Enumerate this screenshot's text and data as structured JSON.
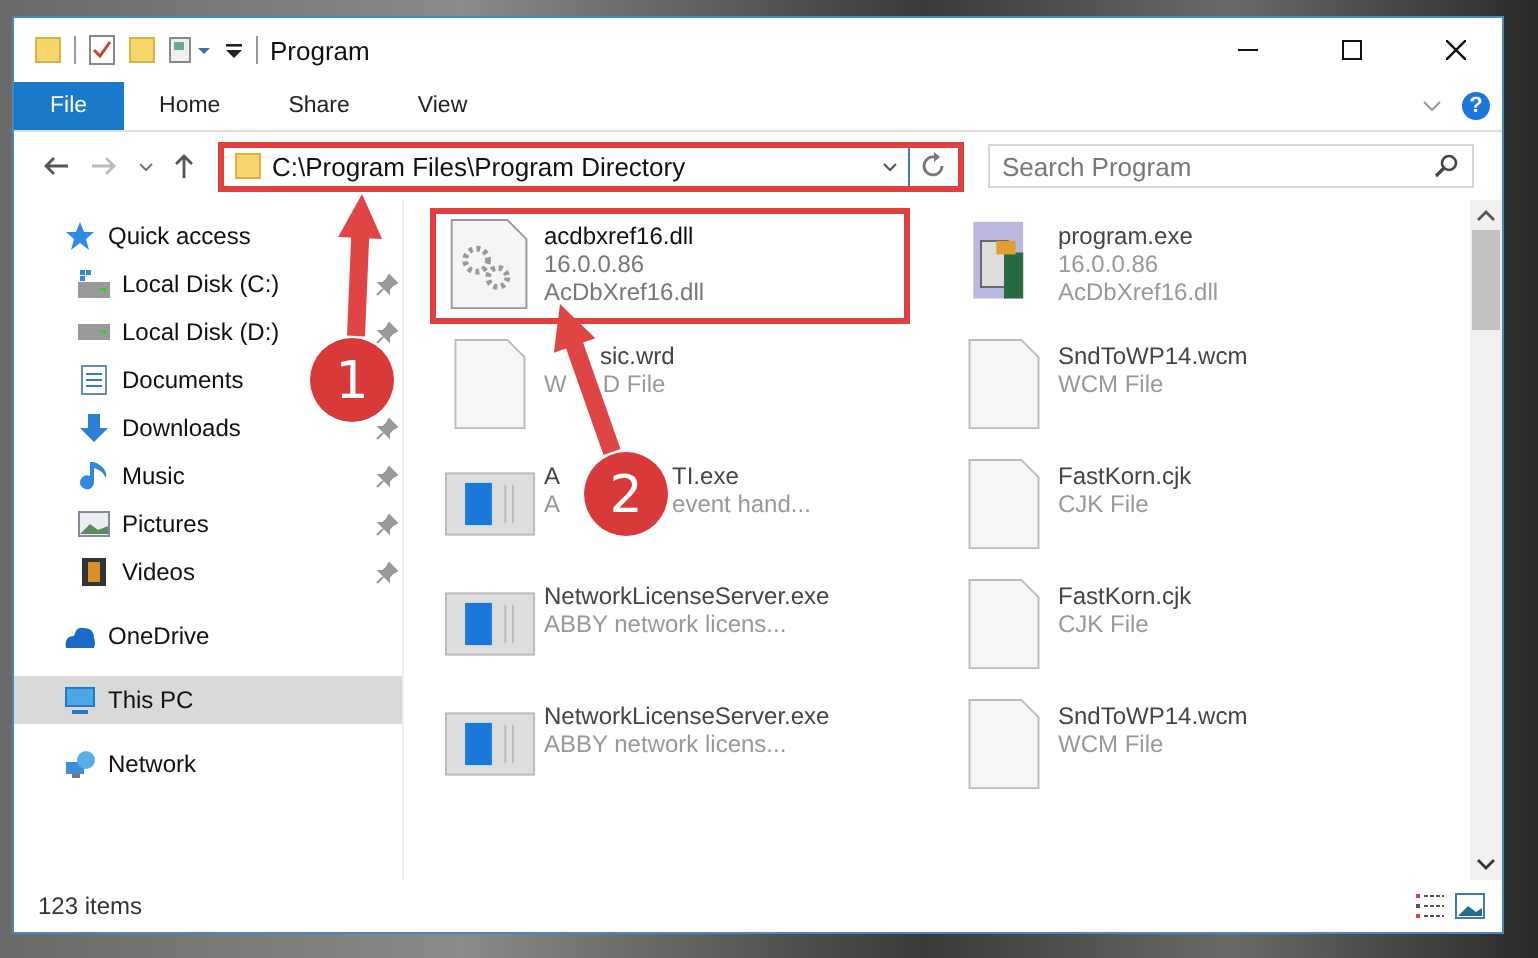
{
  "window": {
    "title": "Program"
  },
  "tabs": [
    {
      "label": "File",
      "kind": "file",
      "selected": false
    },
    {
      "label": "Home",
      "kind": "tab",
      "selected": false
    },
    {
      "label": "Share",
      "kind": "tab",
      "selected": false
    },
    {
      "label": "View",
      "kind": "tab",
      "selected": false
    }
  ],
  "help": "?",
  "address": {
    "path": "C:\\Program Files\\Program Directory",
    "highlighted": true
  },
  "search": {
    "placeholder": "Search Program"
  },
  "sidebar": {
    "items": [
      {
        "label": "Quick access",
        "kind": "quick",
        "selected": false,
        "children": [
          {
            "label": "Local Disk (C:)",
            "kind": "drive-c",
            "pinned": true,
            "selected": false
          },
          {
            "label": "Local Disk (D:)",
            "kind": "drive",
            "pinned": true,
            "selected": false
          },
          {
            "label": "Documents",
            "kind": "documents",
            "pinned": false,
            "selected": false
          },
          {
            "label": "Downloads",
            "kind": "downloads",
            "pinned": true,
            "selected": false
          },
          {
            "label": "Music",
            "kind": "music",
            "pinned": true,
            "selected": false
          },
          {
            "label": "Pictures",
            "kind": "pictures",
            "pinned": true,
            "selected": false
          },
          {
            "label": "Videos",
            "kind": "videos",
            "pinned": true,
            "selected": false
          }
        ]
      },
      {
        "label": "OneDrive",
        "kind": "cloud",
        "selected": false
      },
      {
        "label": "This PC",
        "kind": "pc",
        "selected": true
      },
      {
        "label": "Network",
        "kind": "network",
        "selected": false
      }
    ]
  },
  "files": [
    {
      "name": [
        "acdbxref16.dll"
      ],
      "lines": [
        [
          "16.0.0.86"
        ],
        [
          "AcDbXref16.dll"
        ]
      ],
      "kind": "dll",
      "highlighted": true
    },
    {
      "name": [
        "program.exe"
      ],
      "lines": [
        [
          "16.0.0.86"
        ],
        [
          "AcDbXref16.dll"
        ]
      ],
      "kind": "program",
      "highlighted": false
    },
    {
      "name": [
        "sic.wrd"
      ],
      "name_covered_start": true,
      "lines": [
        [
          "W",
          "D File"
        ]
      ],
      "kind": "blank",
      "highlighted": false
    },
    {
      "name": [
        "SndToWP14.wcm"
      ],
      "lines": [
        [
          "WCM File"
        ]
      ],
      "kind": "blank",
      "highlighted": false
    },
    {
      "name": [
        "A",
        "TI.exe"
      ],
      "lines": [
        [
          "A",
          "event hand..."
        ]
      ],
      "kind": "exe",
      "highlighted": false
    },
    {
      "name": [
        "FastKorn.cjk"
      ],
      "lines": [
        [
          "CJK File"
        ]
      ],
      "kind": "blank",
      "highlighted": false
    },
    {
      "name": [
        "NetworkLicenseServer.exe"
      ],
      "lines": [
        [
          "ABBY network licens..."
        ]
      ],
      "kind": "exe",
      "highlighted": false
    },
    {
      "name": [
        "FastKorn.cjk"
      ],
      "lines": [
        [
          "CJK File"
        ]
      ],
      "kind": "blank",
      "highlighted": false
    },
    {
      "name": [
        "NetworkLicenseServer.exe"
      ],
      "lines": [
        [
          "ABBY network licens..."
        ]
      ],
      "kind": "exe",
      "highlighted": false
    },
    {
      "name": [
        "SndToWP14.wcm"
      ],
      "lines": [
        [
          "WCM File"
        ]
      ],
      "kind": "blank",
      "highlighted": false
    }
  ],
  "status_bar": {
    "count": "123 items"
  },
  "callouts": [
    {
      "number": "1"
    },
    {
      "number": "2"
    }
  ]
}
